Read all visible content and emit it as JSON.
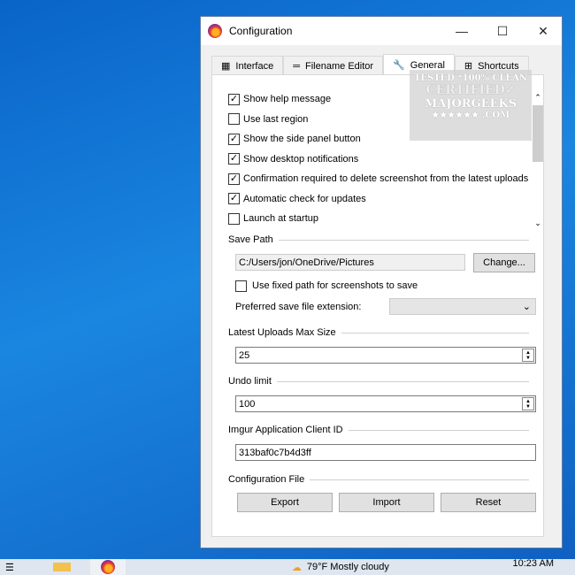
{
  "window": {
    "title": "Configuration"
  },
  "tabs": [
    {
      "label": "Interface",
      "icon": "interface-icon"
    },
    {
      "label": "Filename Editor",
      "icon": "text-lines-icon"
    },
    {
      "label": "General",
      "icon": "wrench-icon"
    },
    {
      "label": "Shortcuts",
      "icon": "grid-icon"
    }
  ],
  "options": [
    {
      "label": "Show help message",
      "checked": true
    },
    {
      "label": "Use last region",
      "checked": false
    },
    {
      "label": "Show the side panel button",
      "checked": true
    },
    {
      "label": "Show desktop notifications",
      "checked": true
    },
    {
      "label": "Confirmation required to delete screenshot from the latest uploads",
      "checked": true
    },
    {
      "label": "Automatic check for updates",
      "checked": true
    },
    {
      "label": "Launch at startup",
      "checked": false
    }
  ],
  "save_path": {
    "label": "Save Path",
    "value": "C:/Users/jon/OneDrive/Pictures",
    "change": "Change...",
    "fixed_label": "Use fixed path for screenshots to save",
    "ext_label": "Preferred save file extension:",
    "ext_value": ""
  },
  "uploads": {
    "label": "Latest Uploads Max Size",
    "value": "25"
  },
  "undo": {
    "label": "Undo limit",
    "value": "100"
  },
  "imgur": {
    "label": "Imgur Application Client ID",
    "value": "313baf0c7b4d3ff"
  },
  "config": {
    "label": "Configuration File",
    "export": "Export",
    "import": "Import",
    "reset": "Reset"
  },
  "watermark": {
    "l1": "TESTED *100% CLEAN",
    "l2": "CERTIFIED",
    "l3": "MAJORGEEKS",
    "l4": ".COM"
  },
  "taskbar": {
    "weather": "79°F  Mostly cloudy",
    "time": "10:23 AM"
  }
}
